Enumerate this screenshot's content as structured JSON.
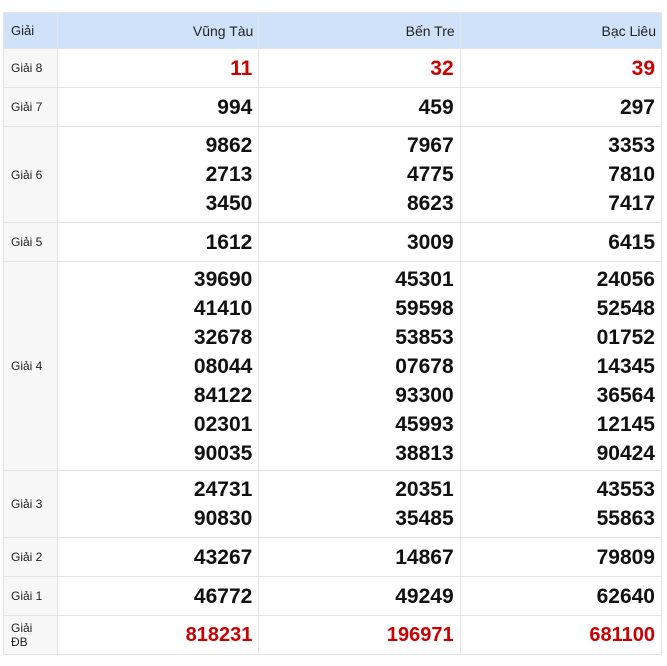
{
  "header": {
    "prize_label": "Giải",
    "provinces": [
      "Vũng Tàu",
      "Bến Tre",
      "Bạc Liêu"
    ]
  },
  "colors": {
    "header_bg": "#cfe2f9",
    "highlight_red": "#cc0000"
  },
  "rows": [
    {
      "label": "Giải 8",
      "values": [
        [
          "11"
        ],
        [
          "32"
        ],
        [
          "39"
        ]
      ]
    },
    {
      "label": "Giải 7",
      "values": [
        [
          "994"
        ],
        [
          "459"
        ],
        [
          "297"
        ]
      ]
    },
    {
      "label": "Giải 6",
      "values": [
        [
          "9862",
          "2713",
          "3450"
        ],
        [
          "7967",
          "4775",
          "8623"
        ],
        [
          "3353",
          "7810",
          "7417"
        ]
      ]
    },
    {
      "label": "Giải 5",
      "values": [
        [
          "1612"
        ],
        [
          "3009"
        ],
        [
          "6415"
        ]
      ]
    },
    {
      "label": "Giải 4",
      "values": [
        [
          "39690",
          "41410",
          "32678",
          "08044",
          "84122",
          "02301",
          "90035"
        ],
        [
          "45301",
          "59598",
          "53853",
          "07678",
          "93300",
          "45993",
          "38813"
        ],
        [
          "24056",
          "52548",
          "01752",
          "14345",
          "36564",
          "12145",
          "90424"
        ]
      ]
    },
    {
      "label": "Giải 3",
      "values": [
        [
          "24731",
          "90830"
        ],
        [
          "20351",
          "35485"
        ],
        [
          "43553",
          "55863"
        ]
      ]
    },
    {
      "label": "Giải 2",
      "values": [
        [
          "43267"
        ],
        [
          "14867"
        ],
        [
          "79809"
        ]
      ]
    },
    {
      "label": "Giải 1",
      "values": [
        [
          "46772"
        ],
        [
          "49249"
        ],
        [
          "62640"
        ]
      ]
    },
    {
      "label": "Giải ĐB",
      "values": [
        [
          "818231"
        ],
        [
          "196971"
        ],
        [
          "681100"
        ]
      ]
    }
  ]
}
